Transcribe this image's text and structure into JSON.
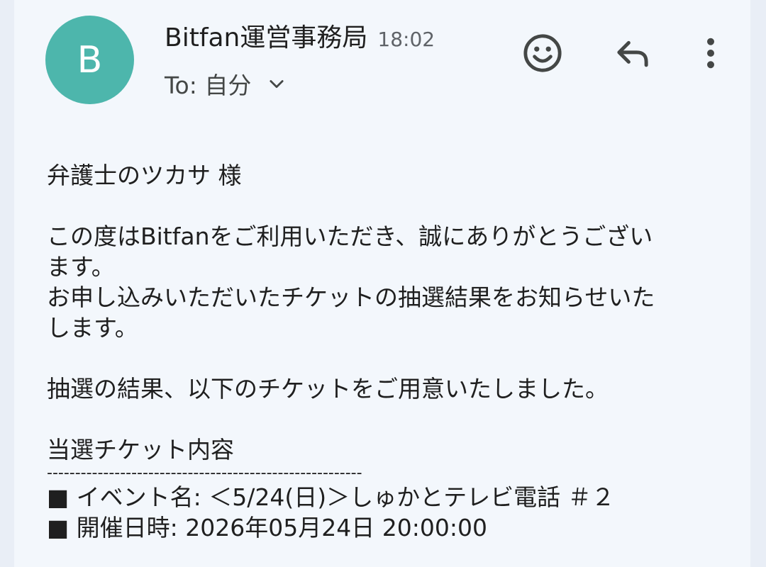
{
  "header": {
    "avatar_letter": "B",
    "sender_name": "Bitfan運営事務局",
    "time": "18:02",
    "to_label": "To: 自分"
  },
  "actions": {
    "emoji": "smiley-icon",
    "reply": "reply-icon",
    "more": "more-vert-icon"
  },
  "body": {
    "salutation": "弁護士のツカサ 様",
    "para1_line1": "この度はBitfanをご利用いただき、誠にありがとうござい",
    "para1_line2": "ます。",
    "para2_line1": "お申し込みいただいたチケットの抽選結果をお知らせいた",
    "para2_line2": "します。",
    "result_line": "抽選の結果、以下のチケットをご用意いたしました。",
    "section_title": "当選チケット内容",
    "divider": "--------------------------------------------------------",
    "event_line": "■ イベント名: ＜5/24(日)＞しゅかとテレビ電話 ＃２",
    "date_line": "■ 開催日時: 2026年05月24日 20:00:00"
  },
  "colors": {
    "avatar": "#4db6ac",
    "background": "#f3f7fc"
  }
}
